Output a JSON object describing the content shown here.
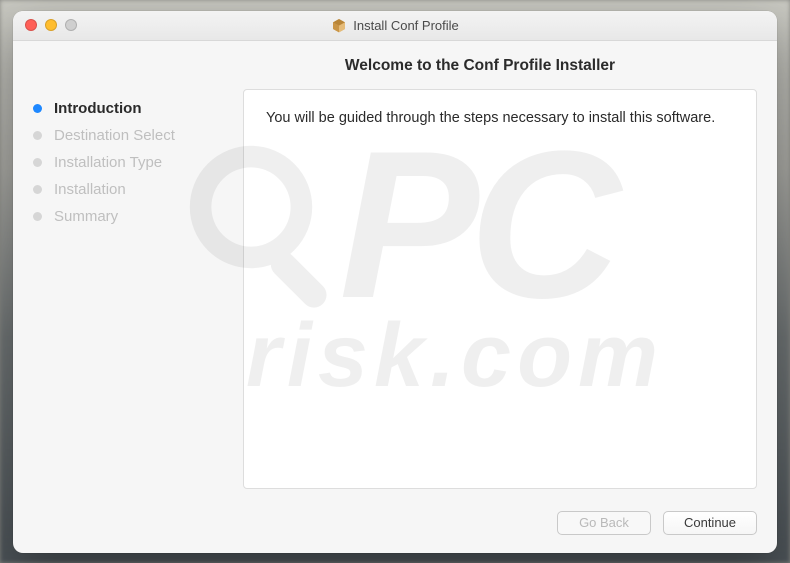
{
  "window": {
    "title": "Install Conf Profile"
  },
  "header": {
    "welcome": "Welcome to the Conf Profile Installer"
  },
  "sidebar": {
    "steps": [
      {
        "label": "Introduction",
        "active": true
      },
      {
        "label": "Destination Select",
        "active": false
      },
      {
        "label": "Installation Type",
        "active": false
      },
      {
        "label": "Installation",
        "active": false
      },
      {
        "label": "Summary",
        "active": false
      }
    ]
  },
  "content": {
    "message": "You will be guided through the steps necessary to install this software."
  },
  "footer": {
    "go_back_label": "Go Back",
    "continue_label": "Continue"
  },
  "watermark": {
    "brand_top": "PC",
    "brand_bottom": "risk.com"
  }
}
